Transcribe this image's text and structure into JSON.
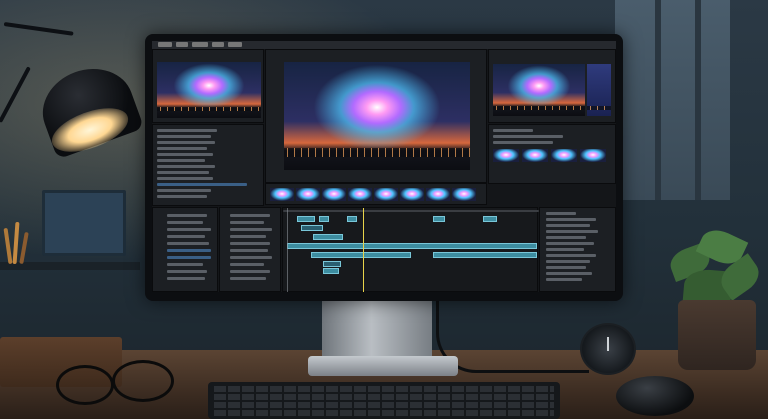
{
  "scene": {
    "description_items": [
      "desk-lamp",
      "computer-monitor",
      "video-editor-interface",
      "keyboard",
      "mouse",
      "potted-plant",
      "clock",
      "eyeglasses",
      "wooden-box"
    ]
  },
  "colors": {
    "wall": "#22303a",
    "desk_wood": "#5b4433",
    "lamp_light": "#ffd792",
    "timeline_clip": "#3d8da0",
    "playhead": "#e8d34a",
    "burst_pink": "#ff9bf3",
    "burst_cyan": "#4ec4ff"
  },
  "editor": {
    "panels": [
      "source-monitor",
      "program-monitor",
      "reference-monitor",
      "project-bin",
      "effects-panel",
      "thumbnail-strip",
      "track-headers",
      "timeline",
      "properties-panel"
    ]
  }
}
